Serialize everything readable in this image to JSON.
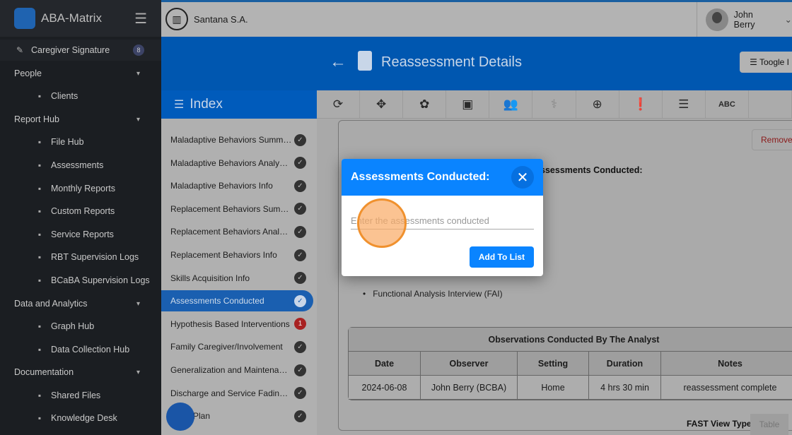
{
  "app": {
    "name": "ABA-Matrix"
  },
  "sidebar": {
    "items": [
      {
        "label": "Caregiver Signature",
        "icon": "signature-icon",
        "badge": "8",
        "type": "top",
        "y": 71
      },
      {
        "label": "People",
        "type": "section"
      },
      {
        "label": "Clients",
        "icon": "user-icon",
        "type": "sub"
      },
      {
        "label": "Report Hub",
        "type": "section"
      },
      {
        "label": "File Hub",
        "icon": "cloud-icon",
        "type": "sub"
      },
      {
        "label": "Assessments",
        "icon": "clipboard-icon",
        "type": "sub"
      },
      {
        "label": "Monthly Reports",
        "icon": "report-icon",
        "type": "sub"
      },
      {
        "label": "Custom Reports",
        "icon": "document-icon",
        "type": "sub"
      },
      {
        "label": "Service Reports",
        "icon": "service-icon",
        "type": "sub"
      },
      {
        "label": "RBT Supervision Logs",
        "icon": "monitor-icon",
        "type": "sub"
      },
      {
        "label": "BCaBA Supervision Logs",
        "icon": "monitor-icon",
        "type": "sub"
      },
      {
        "label": "Data and Analytics",
        "type": "section"
      },
      {
        "label": "Graph Hub",
        "icon": "chart-icon",
        "type": "sub"
      },
      {
        "label": "Data Collection Hub",
        "icon": "data-icon",
        "type": "sub"
      },
      {
        "label": "Documentation",
        "type": "section"
      },
      {
        "label": "Shared Files",
        "icon": "shared-icon",
        "type": "sub"
      },
      {
        "label": "Knowledge Desk",
        "icon": "graduation-icon",
        "type": "sub"
      }
    ]
  },
  "header": {
    "company": "Santana S.A.",
    "user": "John Berry"
  },
  "page": {
    "title": "Reassessment Details",
    "toggle": "Toogle I"
  },
  "index": {
    "title": "Index",
    "items": [
      {
        "label": "Maladaptive Behaviors Summary",
        "status": "done"
      },
      {
        "label": "Maladaptive Behaviors Analysis ...",
        "status": "done"
      },
      {
        "label": "Maladaptive Behaviors Info",
        "status": "done"
      },
      {
        "label": "Replacement Behaviors Summary",
        "status": "done"
      },
      {
        "label": "Replacement Behaviors Analysis...",
        "status": "done"
      },
      {
        "label": "Replacement Behaviors Info",
        "status": "done"
      },
      {
        "label": "Skills Acquisition Info",
        "status": "done"
      },
      {
        "label": "Assessments Conducted",
        "status": "active"
      },
      {
        "label": "Hypothesis Based Interventions",
        "status": "1"
      },
      {
        "label": "Family Caregiver/Involvement",
        "status": "done"
      },
      {
        "label": "Generalization and Maintenance",
        "status": "done"
      },
      {
        "label": "Discharge and Service Fading Pl...",
        "status": "done"
      },
      {
        "label": "Plan",
        "status": "done"
      }
    ]
  },
  "content": {
    "remove": "Remove",
    "section_label": "Assessments Conducted:",
    "list": [
      "Functional Analysis Interview (FAI)"
    ],
    "table": {
      "title": "Observations Conducted By The Analyst",
      "headers": [
        "Date",
        "Observer",
        "Setting",
        "Duration",
        "Notes"
      ],
      "rows": [
        [
          "2024-06-08",
          "John Berry (BCBA)",
          "Home",
          "4 hrs 30 min",
          "reassessment complete"
        ]
      ]
    },
    "fast_label": "FAST View Type:",
    "fast_value": "Table"
  },
  "modal": {
    "title": "Assessments Conducted:",
    "placeholder": "Enter the assessments conducted",
    "add": "Add To List"
  }
}
